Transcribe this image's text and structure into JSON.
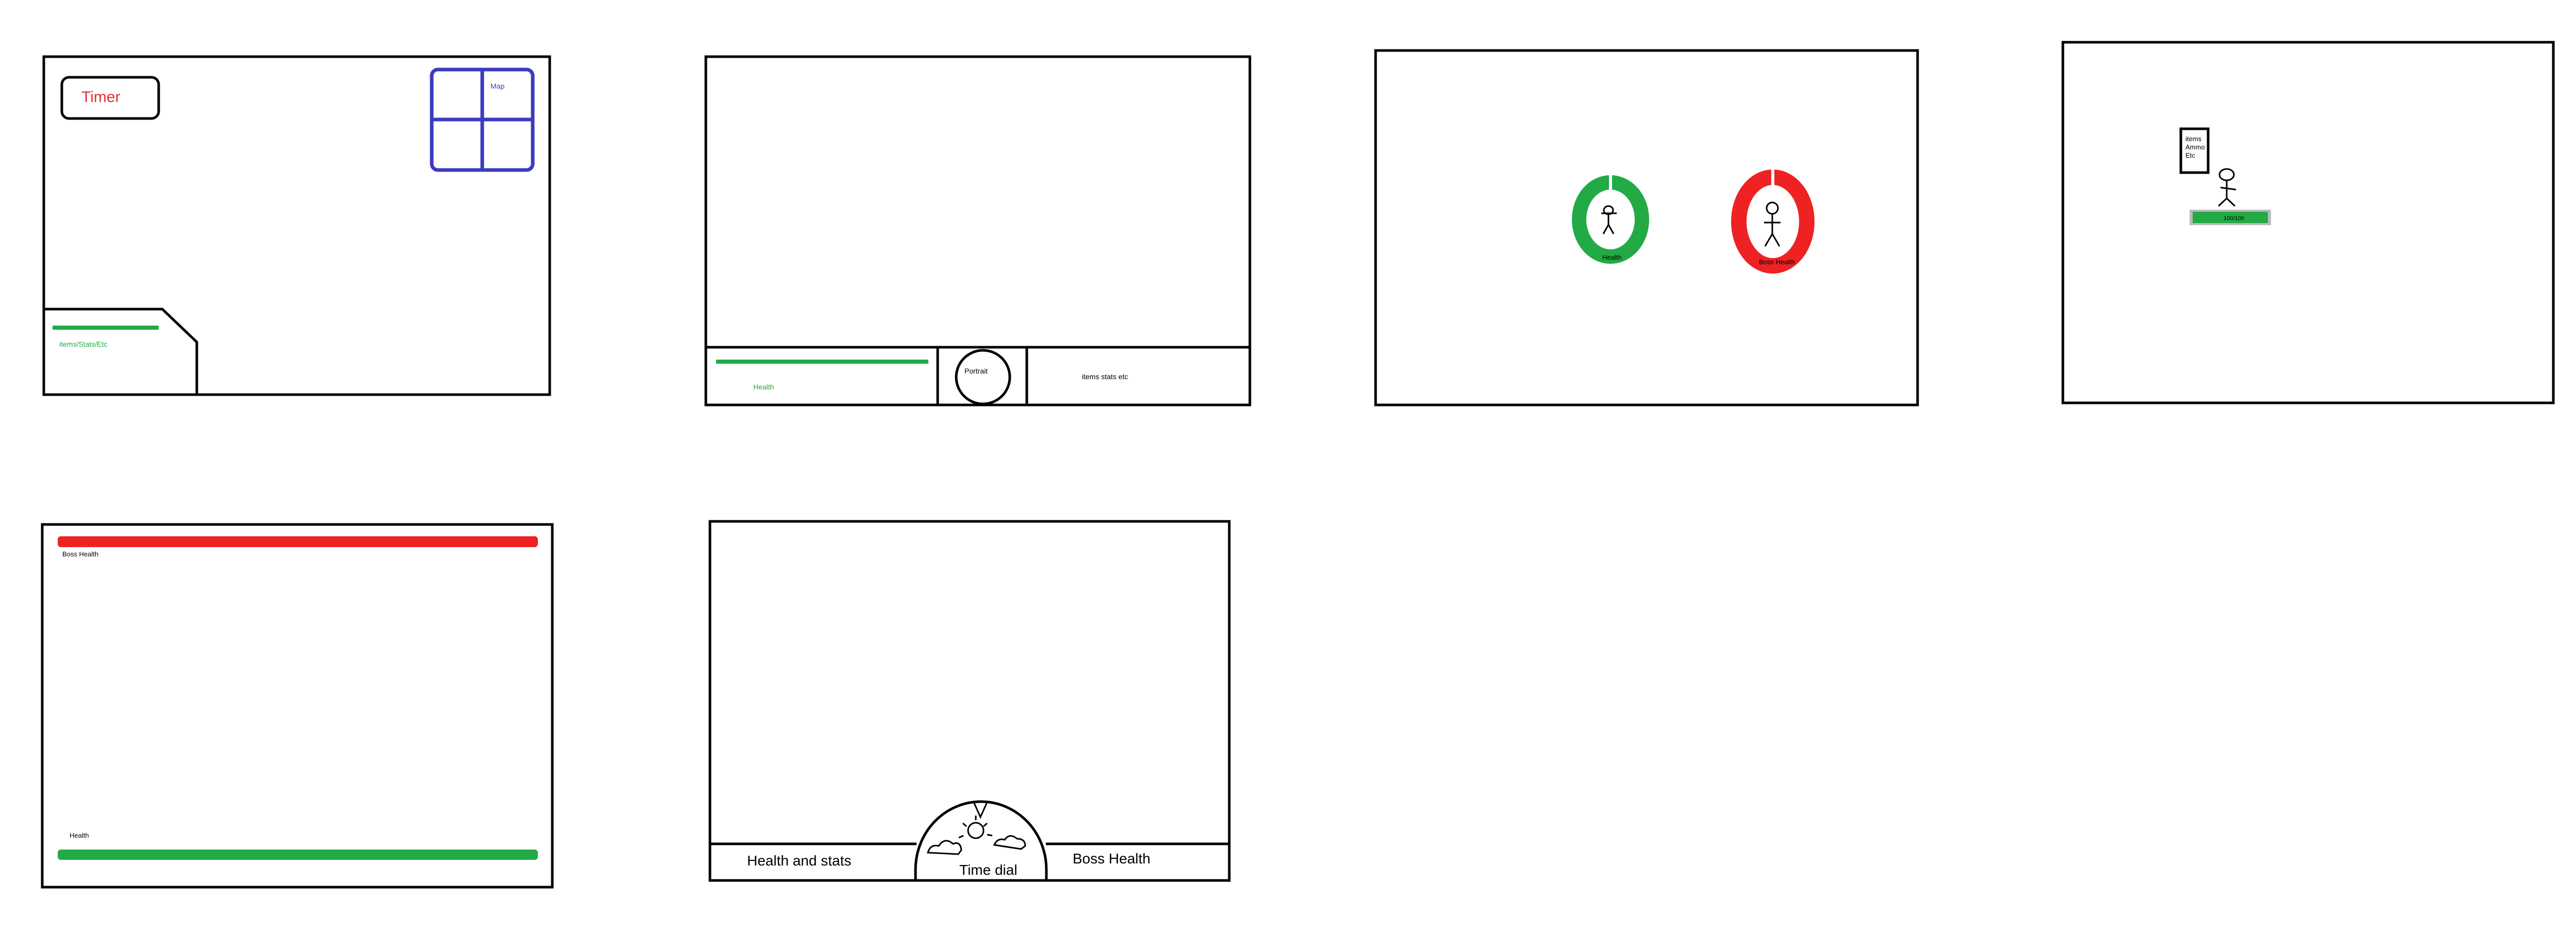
{
  "palette": {
    "line": "#000000",
    "health_green": "#22aa44",
    "boss_red": "#ee2222",
    "map_blue": "#3b3bbf",
    "timer_red": "#e03030",
    "bar_grey": "#bbbbbb"
  },
  "mockups": [
    {
      "name": "corner-hud",
      "timer_label": "Timer",
      "map_label": "Map",
      "stats_label": "items/Stats/Etc"
    },
    {
      "name": "bottom-bar-hud",
      "health_label": "Health",
      "portrait_label": "Portrait",
      "stats_label": "items stats etc"
    },
    {
      "name": "ring-hud",
      "left_ring_label": "Health",
      "right_ring_label": "Boss Health"
    },
    {
      "name": "floating-hud",
      "info_lines": [
        "items",
        "Ammo",
        "Etc"
      ],
      "health_bar_label": "100/100"
    },
    {
      "name": "full-width-bars-hud",
      "boss_label": "Boss Health",
      "health_label": "Health"
    },
    {
      "name": "time-dial-hud",
      "left_label": "Health and stats",
      "dial_label": "Time dial",
      "right_label": "Boss Health"
    }
  ]
}
